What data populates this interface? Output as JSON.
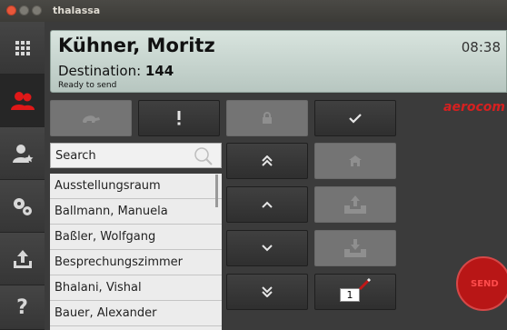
{
  "window": {
    "title": "thalassa"
  },
  "header": {
    "name": "Kühner, Moritz",
    "time": "08:38",
    "destination_label": "Destination:",
    "destination_value": "144",
    "status": "Ready to send"
  },
  "brand": "aerocom",
  "search": {
    "placeholder": "Search"
  },
  "list": {
    "items": [
      "Ausstellungsraum",
      "Ballmann, Manuela",
      "Baßler, Wolfgang",
      "Besprechungszimmer",
      "Bhalani, Vishal",
      "Bauer, Alexander"
    ]
  },
  "counter": "1",
  "send": "SEND",
  "sidebar": {
    "items": [
      "grid-icon",
      "contacts-icon",
      "user-star-icon",
      "settings-icon",
      "upload-icon",
      "help-icon"
    ],
    "help_label": "?"
  },
  "colors": {
    "accent": "#d62020",
    "header_bg": "#c8d6d0",
    "active_icon": "#e01818"
  }
}
